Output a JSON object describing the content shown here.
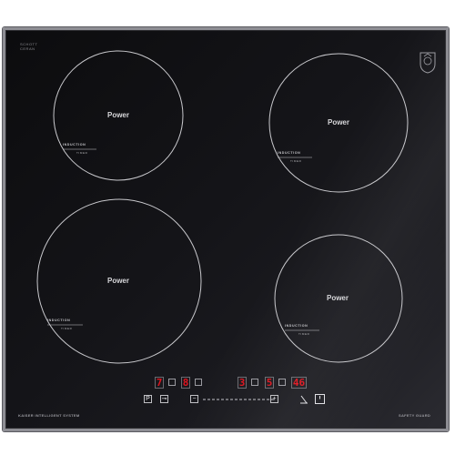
{
  "brand": {
    "schott_line1": "SCHOTT",
    "schott_line2": "CERAN"
  },
  "zones": [
    {
      "label": "Power",
      "induction": "INDUCTION",
      "timer": "TIMER"
    },
    {
      "label": "Power",
      "induction": "INDUCTION",
      "timer": "TIMER"
    },
    {
      "label": "Power",
      "induction": "INDUCTION",
      "timer": "TIMER"
    },
    {
      "label": "Power",
      "induction": "INDUCTION",
      "timer": "TIMER"
    }
  ],
  "panel": {
    "zone1_level": "7",
    "zone2_level": "8",
    "zone3_level": "3",
    "zone4_level": "5",
    "timer_value": "46",
    "pause_label": "P",
    "lock_label": "⊸",
    "minus_label": "−",
    "plus_label": "+",
    "timer_icon": "clock-icon",
    "power_icon": "power-icon",
    "footer_left": "KAISER INTELLIGENT SYSTEM",
    "footer_right": "SAFETY GUARD"
  },
  "colors": {
    "display_red": "#e0141e",
    "glass": "#141418",
    "frame": "#8e8e94"
  }
}
